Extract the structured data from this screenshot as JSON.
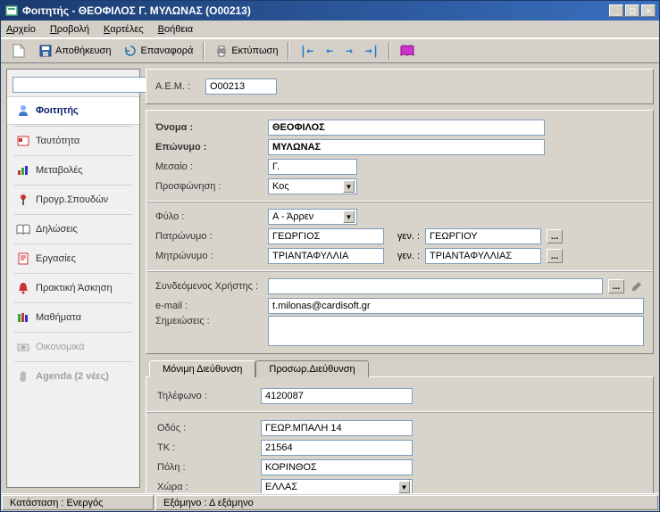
{
  "window": {
    "title": "Φοιτητής - ΘΕΟΦΙΛΟΣ Γ. ΜΥΛΩΝΑΣ (O00213)"
  },
  "menu": {
    "file": "Αρχείο",
    "view": "Προβολή",
    "cards": "Καρτέλες",
    "help": "Βοήθεια",
    "file_ul": "Α",
    "view_ul": "Π",
    "cards_ul": "Κ",
    "help_ul": "Β",
    "file_rest": "ρχείο",
    "view_rest": "ροβολή",
    "cards_rest": "αρτέλες",
    "help_rest": "οήθεια"
  },
  "toolbar": {
    "save": "Αποθήκευση",
    "reset": "Επαναφορά",
    "print": "Εκτύπωση"
  },
  "sidebar": {
    "items": [
      {
        "label": "Φοιτητής"
      },
      {
        "label": "Ταυτότητα"
      },
      {
        "label": "Μεταβολές"
      },
      {
        "label": "Προγρ.Σπουδών"
      },
      {
        "label": "Δηλώσεις"
      },
      {
        "label": "Εργασίες"
      },
      {
        "label": "Πρακτική Άσκηση"
      },
      {
        "label": "Μαθήματα"
      },
      {
        "label": "Οικονομικά"
      },
      {
        "label": "Agenda (2 νέες)"
      }
    ]
  },
  "form": {
    "aem_label": "Α.Ε.Μ. :",
    "aem_value": "O00213",
    "firstname_label": "Όνομα :",
    "firstname_value": "ΘΕΟΦΙΛΟΣ",
    "lastname_label": "Επώνυμο :",
    "lastname_value": "ΜΥΛΩΝΑΣ",
    "middle_label": "Μεσαίο :",
    "middle_value": "Γ.",
    "salutation_label": "Προσφώνηση :",
    "salutation_value": "Κος",
    "gender_label": "Φύλο :",
    "gender_value": "Α - Άρρεν",
    "father_label": "Πατρώνυμο :",
    "father_value": "ΓΕΩΡΓΙΟΣ",
    "gen_label": "γεν. :",
    "father_gen": "ΓΕΩΡΓΙΟΥ",
    "mother_label": "Μητρώνυμο :",
    "mother_value": "ΤΡΙΑΝΤΑΦΥΛΛΙΑ",
    "mother_gen": "ΤΡΙΑΝΤΑΦΥΛΛΙΑΣ",
    "linked_user_label": "Συνδεόμενος Χρήστης :",
    "linked_user_value": "",
    "email_label": "e-mail :",
    "email_value": "t.milonas@cardisoft.gr",
    "notes_label": "Σημειώσεις :",
    "notes_value": ""
  },
  "tabs": {
    "permanent": "Μόνιμη Διεύθυνση",
    "temporary": "Προσωρ.Διεύθυνση"
  },
  "address": {
    "phone_label": "Τηλέφωνο :",
    "phone_value": "4120087",
    "street_label": "Οδός :",
    "street_value": "ΓΕΩΡ.ΜΠΑΛΗ 14",
    "zip_label": "ΤΚ :",
    "zip_value": "21564",
    "city_label": "Πόλη :",
    "city_value": "ΚΟΡΙΝΘΟΣ",
    "country_label": "Χώρα :",
    "country_value": "ΕΛΛΑΣ"
  },
  "status": {
    "state": "Κατάσταση : Ενεργός",
    "semester": "Εξάμηνο : Δ εξάμηνο"
  },
  "colors": {
    "titlebar_start": "#1a3b6f",
    "titlebar_end": "#3a6fbf",
    "bg": "#d4d0c8"
  }
}
